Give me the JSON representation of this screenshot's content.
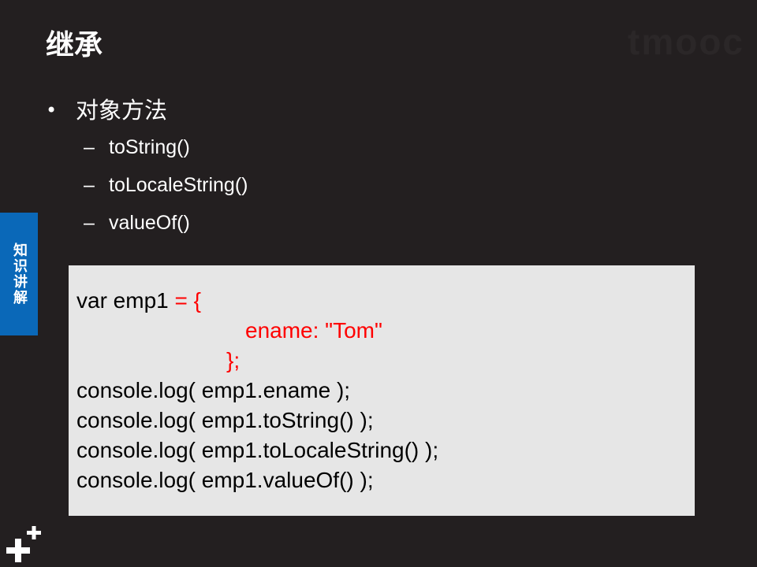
{
  "slide": {
    "title": "继承",
    "watermark": "tmooc",
    "side_tab_label": "知识讲解",
    "bullet": "对象方法",
    "bullet_marker": "•",
    "sub_marker": "–",
    "sub_items": [
      "toString()",
      "toLocaleString()",
      "valueOf()"
    ]
  },
  "code": {
    "line1_black": "var emp1 ",
    "line1_red": "= {",
    "line2_red": "ename: \"Tom\"",
    "line3_red": "};",
    "line4": "console.log( emp1.ename );",
    "line5": "console.log( emp1.toString() );",
    "line6": "console.log( emp1.toLocaleString() );",
    "line7": "console.log( emp1.valueOf() );"
  },
  "colors": {
    "background": "#231f20",
    "code_background": "#e6e6e6",
    "highlight": "#ff0000",
    "side_tab": "#0a68b8"
  },
  "icons": {
    "logo": "double-plus-icon"
  }
}
